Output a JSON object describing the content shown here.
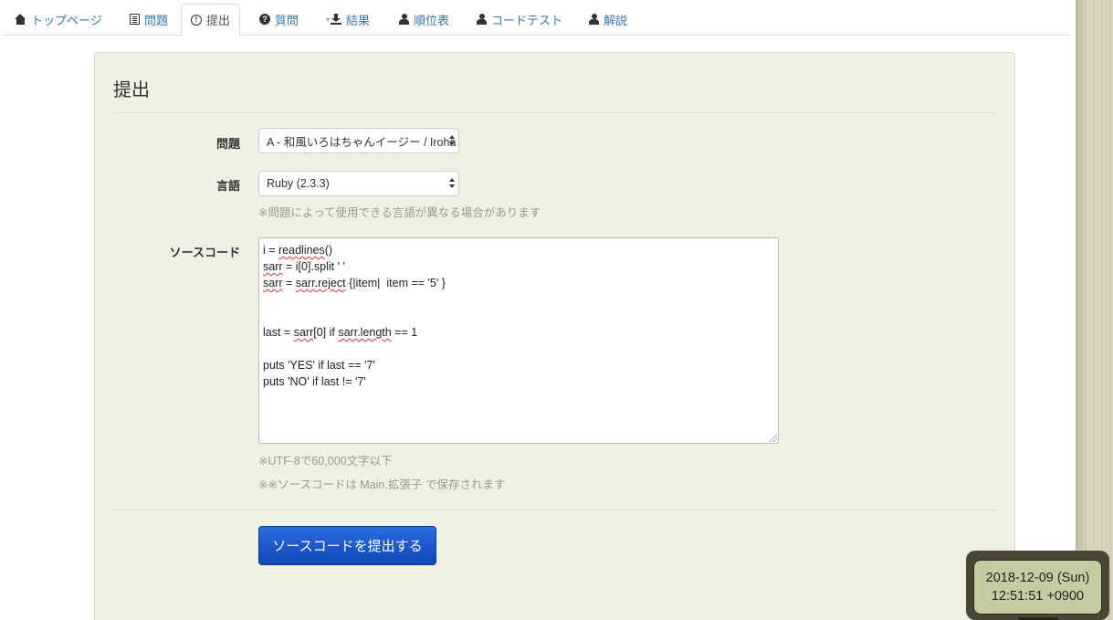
{
  "tabs": [
    {
      "label": "トップページ",
      "icon": "home-icon"
    },
    {
      "label": "問題",
      "icon": "list-icon"
    },
    {
      "label": "提出",
      "icon": "info-circle-icon"
    },
    {
      "label": "質問",
      "icon": "question-circle-icon"
    },
    {
      "label": "結果",
      "icon": "download-icon"
    },
    {
      "label": "順位表",
      "icon": "user-icon"
    },
    {
      "label": "コードテスト",
      "icon": "user-icon"
    },
    {
      "label": "解説",
      "icon": "user-icon"
    }
  ],
  "active_tab": "提出",
  "panel": {
    "title": "提出",
    "problem_label": "問題",
    "problem_value": "A - 和風いろはちゃんイージー / Iroha and Haiku (ABC Edition)",
    "language_label": "言語",
    "language_value": "Ruby (2.3.3)",
    "language_help": "※問題によって使用できる言語が異なる場合があります",
    "source_label": "ソースコード",
    "source_help_1": "※UTF-8で60,000文字以下",
    "source_help_2": "※※ソースコードは Main.拡張子 で保存されます",
    "submit_label": "ソースコードを提出する"
  },
  "source_code": [
    "i = readlines()",
    "sarr = i[0].split ' '",
    "sarr = sarr.reject {|item|  item == '5' }",
    "",
    "",
    "last = sarr[0] if sarr.length == 1",
    "",
    "puts 'YES' if last == '7'",
    "puts 'NO' if last != '7'"
  ],
  "clock": {
    "date": "2018-12-09 (Sun)",
    "time": "12:51:51 +0900"
  },
  "colors": {
    "link": "#337ab7",
    "panel_bg": "#eff2e3",
    "submit_button": "#1656c9",
    "help_text": "#989a8c"
  }
}
